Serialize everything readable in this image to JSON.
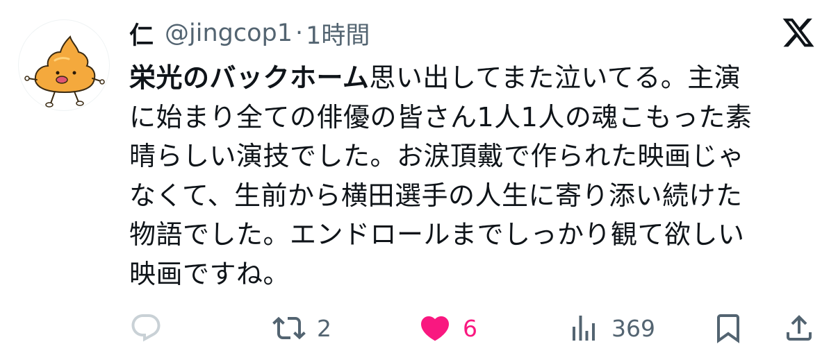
{
  "author": {
    "display_name": "仁",
    "handle": "@jingcop1",
    "separator": "·",
    "time": "1時間"
  },
  "logo_icon": "x-logo-icon",
  "body": {
    "line1_bold": "栄光のバックホーム",
    "line1_rest": "思い出してまた泣いてる。主演",
    "line2": "に始まり全ての俳優の皆さん1人1人の魂こもった素",
    "line3": "晴らしい演技でした。お涙頂戴で作られた映画じゃ",
    "line4": "なくて、生前から横田選手の人生に寄り添い続けた",
    "line5": "物語でした。エンドロールまでしっかり観て欲しい",
    "line6": "映画ですね。"
  },
  "actions": {
    "reply": {
      "icon": "reply-icon",
      "count": ""
    },
    "retweet": {
      "icon": "retweet-icon",
      "count": "2"
    },
    "like": {
      "icon": "heart-icon",
      "count": "6",
      "color": "#f91880"
    },
    "views": {
      "icon": "views-icon",
      "count": "369"
    },
    "bookmark": {
      "icon": "bookmark-icon"
    },
    "share": {
      "icon": "share-icon"
    }
  },
  "colors": {
    "text": "#0f1419",
    "secondary": "#536471",
    "like": "#f91880"
  }
}
